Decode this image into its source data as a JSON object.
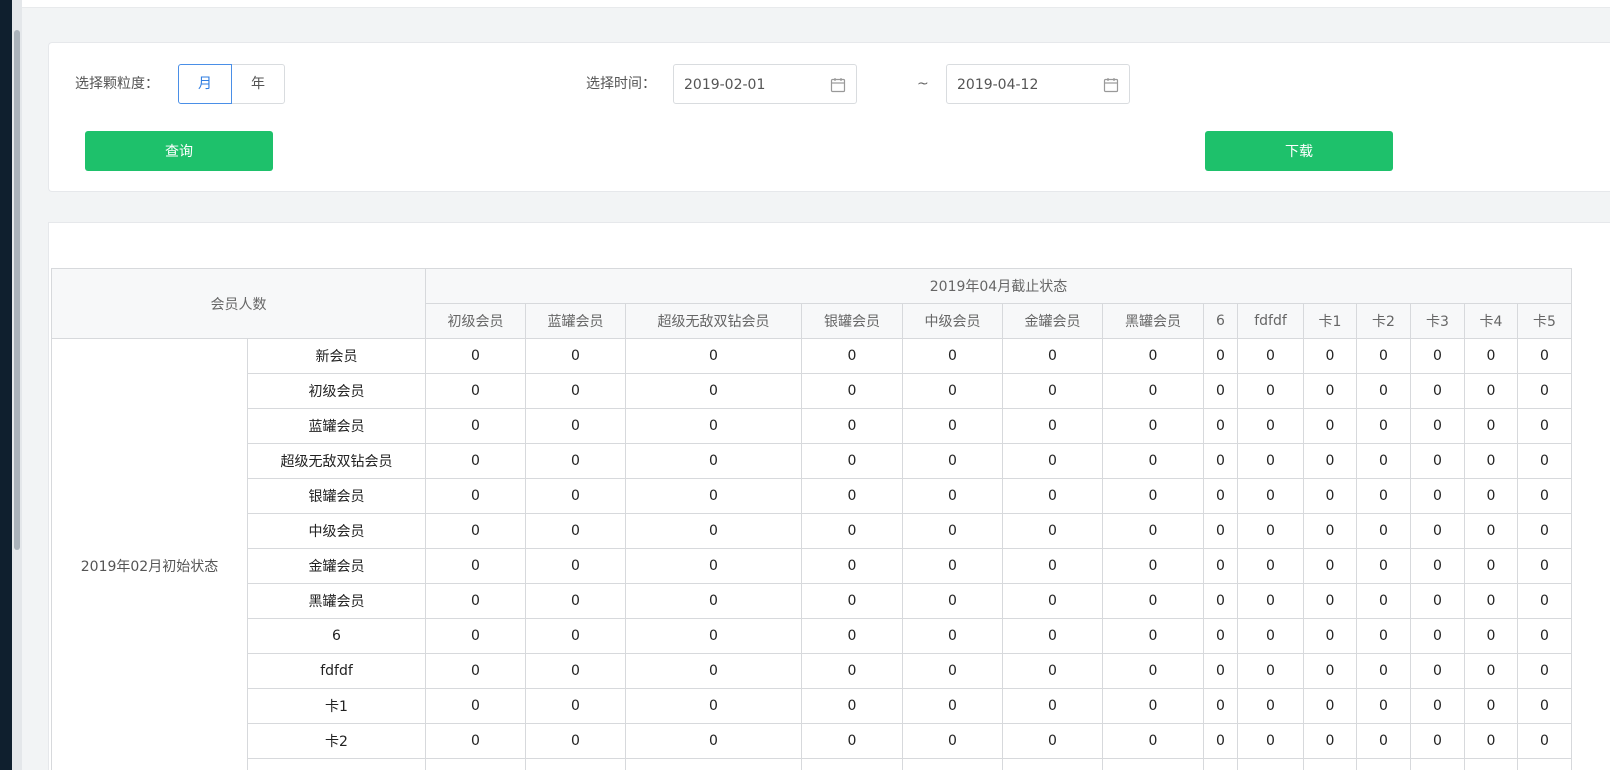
{
  "filter": {
    "granularity_label": "选择颗粒度：",
    "granularity_options": [
      "月",
      "年"
    ],
    "granularity_selected": "月",
    "time_label": "选择时间：",
    "start_date": "2019-02-01",
    "separator": "~",
    "end_date": "2019-04-12",
    "query_button": "查询",
    "download_button": "下载"
  },
  "table": {
    "corner_header": "会员人数",
    "group_header": "2019年04月截止状态",
    "columns": [
      "初级会员",
      "蓝罐会员",
      "超级无敌双钻会员",
      "银罐会员",
      "中级会员",
      "金罐会员",
      "黑罐会员",
      "6",
      "fdfdf",
      "卡1",
      "卡2",
      "卡3",
      "卡4",
      "卡5"
    ],
    "row_group_label": "2019年02月初始状态",
    "rows": [
      {
        "label": "新会员",
        "values": [
          "0",
          "0",
          "0",
          "0",
          "0",
          "0",
          "0",
          "0",
          "0",
          "0",
          "0",
          "0",
          "0",
          "0"
        ]
      },
      {
        "label": "初级会员",
        "values": [
          "0",
          "0",
          "0",
          "0",
          "0",
          "0",
          "0",
          "0",
          "0",
          "0",
          "0",
          "0",
          "0",
          "0"
        ]
      },
      {
        "label": "蓝罐会员",
        "values": [
          "0",
          "0",
          "0",
          "0",
          "0",
          "0",
          "0",
          "0",
          "0",
          "0",
          "0",
          "0",
          "0",
          "0"
        ]
      },
      {
        "label": "超级无敌双钻会员",
        "values": [
          "0",
          "0",
          "0",
          "0",
          "0",
          "0",
          "0",
          "0",
          "0",
          "0",
          "0",
          "0",
          "0",
          "0"
        ]
      },
      {
        "label": "银罐会员",
        "values": [
          "0",
          "0",
          "0",
          "0",
          "0",
          "0",
          "0",
          "0",
          "0",
          "0",
          "0",
          "0",
          "0",
          "0"
        ]
      },
      {
        "label": "中级会员",
        "values": [
          "0",
          "0",
          "0",
          "0",
          "0",
          "0",
          "0",
          "0",
          "0",
          "0",
          "0",
          "0",
          "0",
          "0"
        ]
      },
      {
        "label": "金罐会员",
        "values": [
          "0",
          "0",
          "0",
          "0",
          "0",
          "0",
          "0",
          "0",
          "0",
          "0",
          "0",
          "0",
          "0",
          "0"
        ]
      },
      {
        "label": "黑罐会员",
        "values": [
          "0",
          "0",
          "0",
          "0",
          "0",
          "0",
          "0",
          "0",
          "0",
          "0",
          "0",
          "0",
          "0",
          "0"
        ]
      },
      {
        "label": "6",
        "values": [
          "0",
          "0",
          "0",
          "0",
          "0",
          "0",
          "0",
          "0",
          "0",
          "0",
          "0",
          "0",
          "0",
          "0"
        ]
      },
      {
        "label": "fdfdf",
        "values": [
          "0",
          "0",
          "0",
          "0",
          "0",
          "0",
          "0",
          "0",
          "0",
          "0",
          "0",
          "0",
          "0",
          "0"
        ]
      },
      {
        "label": "卡1",
        "values": [
          "0",
          "0",
          "0",
          "0",
          "0",
          "0",
          "0",
          "0",
          "0",
          "0",
          "0",
          "0",
          "0",
          "0"
        ]
      },
      {
        "label": "卡2",
        "values": [
          "0",
          "0",
          "0",
          "0",
          "0",
          "0",
          "0",
          "0",
          "0",
          "0",
          "0",
          "0",
          "0",
          "0"
        ]
      }
    ]
  },
  "icons": {
    "calendar": "calendar-icon"
  },
  "colors": {
    "primary_button": "#1ec16b",
    "active_segment": "#2f7de1"
  }
}
